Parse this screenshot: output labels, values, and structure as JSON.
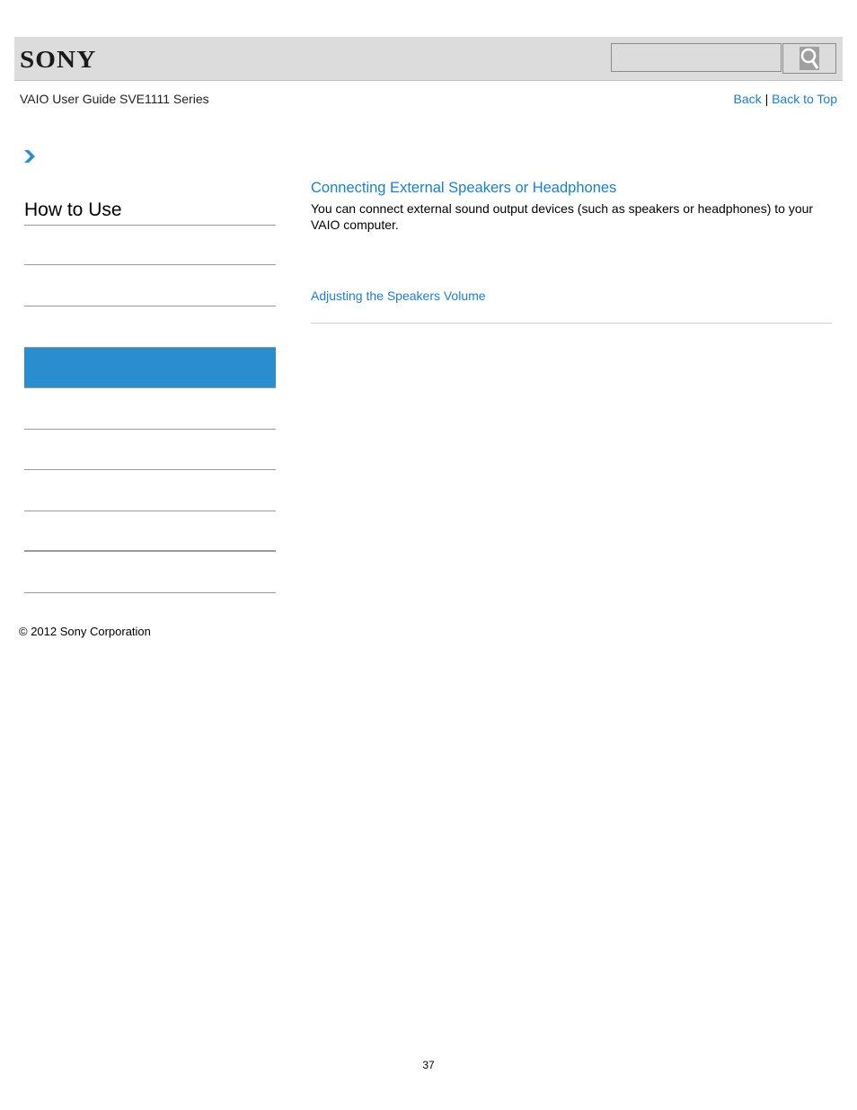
{
  "header": {
    "logo_text": "SONY",
    "search": {
      "value": "",
      "placeholder": ""
    },
    "search_button_icon": "search-icon"
  },
  "subheader": {
    "guide_title": "VAIO User Guide SVE1111 Series",
    "back_label": "Back",
    "separator": "|",
    "back_to_top_label": "Back to Top"
  },
  "breadcrumb": {
    "icon": "chevron-right-icon"
  },
  "sidebar": {
    "title": "How to Use",
    "items": [
      {
        "label": "",
        "active": false
      },
      {
        "label": "",
        "active": false
      },
      {
        "label": "",
        "active": true
      },
      {
        "label": "",
        "active": false
      },
      {
        "label": "",
        "active": false
      },
      {
        "label": "",
        "active": false
      },
      {
        "label": "",
        "active": false
      },
      {
        "label": "",
        "active": false
      }
    ]
  },
  "main": {
    "title": "Connecting External Speakers or Headphones",
    "description": "You can connect external sound output devices (such as speakers or headphones) to your VAIO computer.",
    "related_link": "Adjusting the Speakers Volume"
  },
  "footer": {
    "copyright": "© 2012 Sony Corporation",
    "page_number": "37"
  },
  "colors": {
    "accent": "#1a7fcf",
    "active_item": "#2a8dcd",
    "header_bg": "#dcdcdc"
  }
}
